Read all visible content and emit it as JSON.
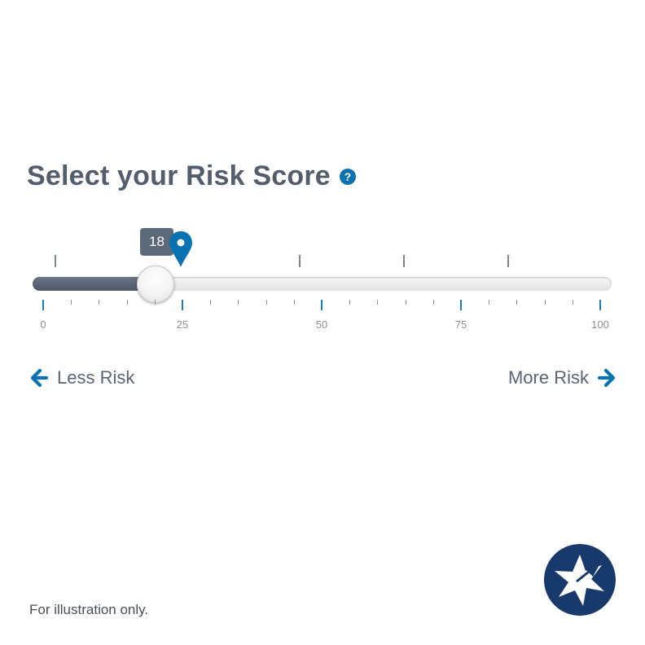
{
  "header": {
    "title": "Select your Risk Score",
    "help_icon": "question-circle-icon",
    "help_symbol": "?"
  },
  "slider": {
    "value": 18,
    "value_label": "18",
    "min": 0,
    "max": 100,
    "major_ticks": [
      {
        "value": 0,
        "label": "0"
      },
      {
        "value": 25,
        "label": "25"
      },
      {
        "value": 50,
        "label": "50"
      },
      {
        "value": 75,
        "label": "75"
      },
      {
        "value": 100,
        "label": "100"
      }
    ],
    "marker_icon": "map-pin-icon"
  },
  "risk": {
    "less_label": "Less Risk",
    "more_label": "More Risk",
    "less_icon": "arrow-left-icon",
    "more_icon": "arrow-right-icon"
  },
  "footer": {
    "disclaimer": "For illustration only.",
    "logo_icon": "star-compass-logo"
  },
  "colors": {
    "accent_blue": "#0b72b1",
    "fill_gray": "#535d6c",
    "text_gray": "#535d6c",
    "logo_navy": "#17396b"
  }
}
